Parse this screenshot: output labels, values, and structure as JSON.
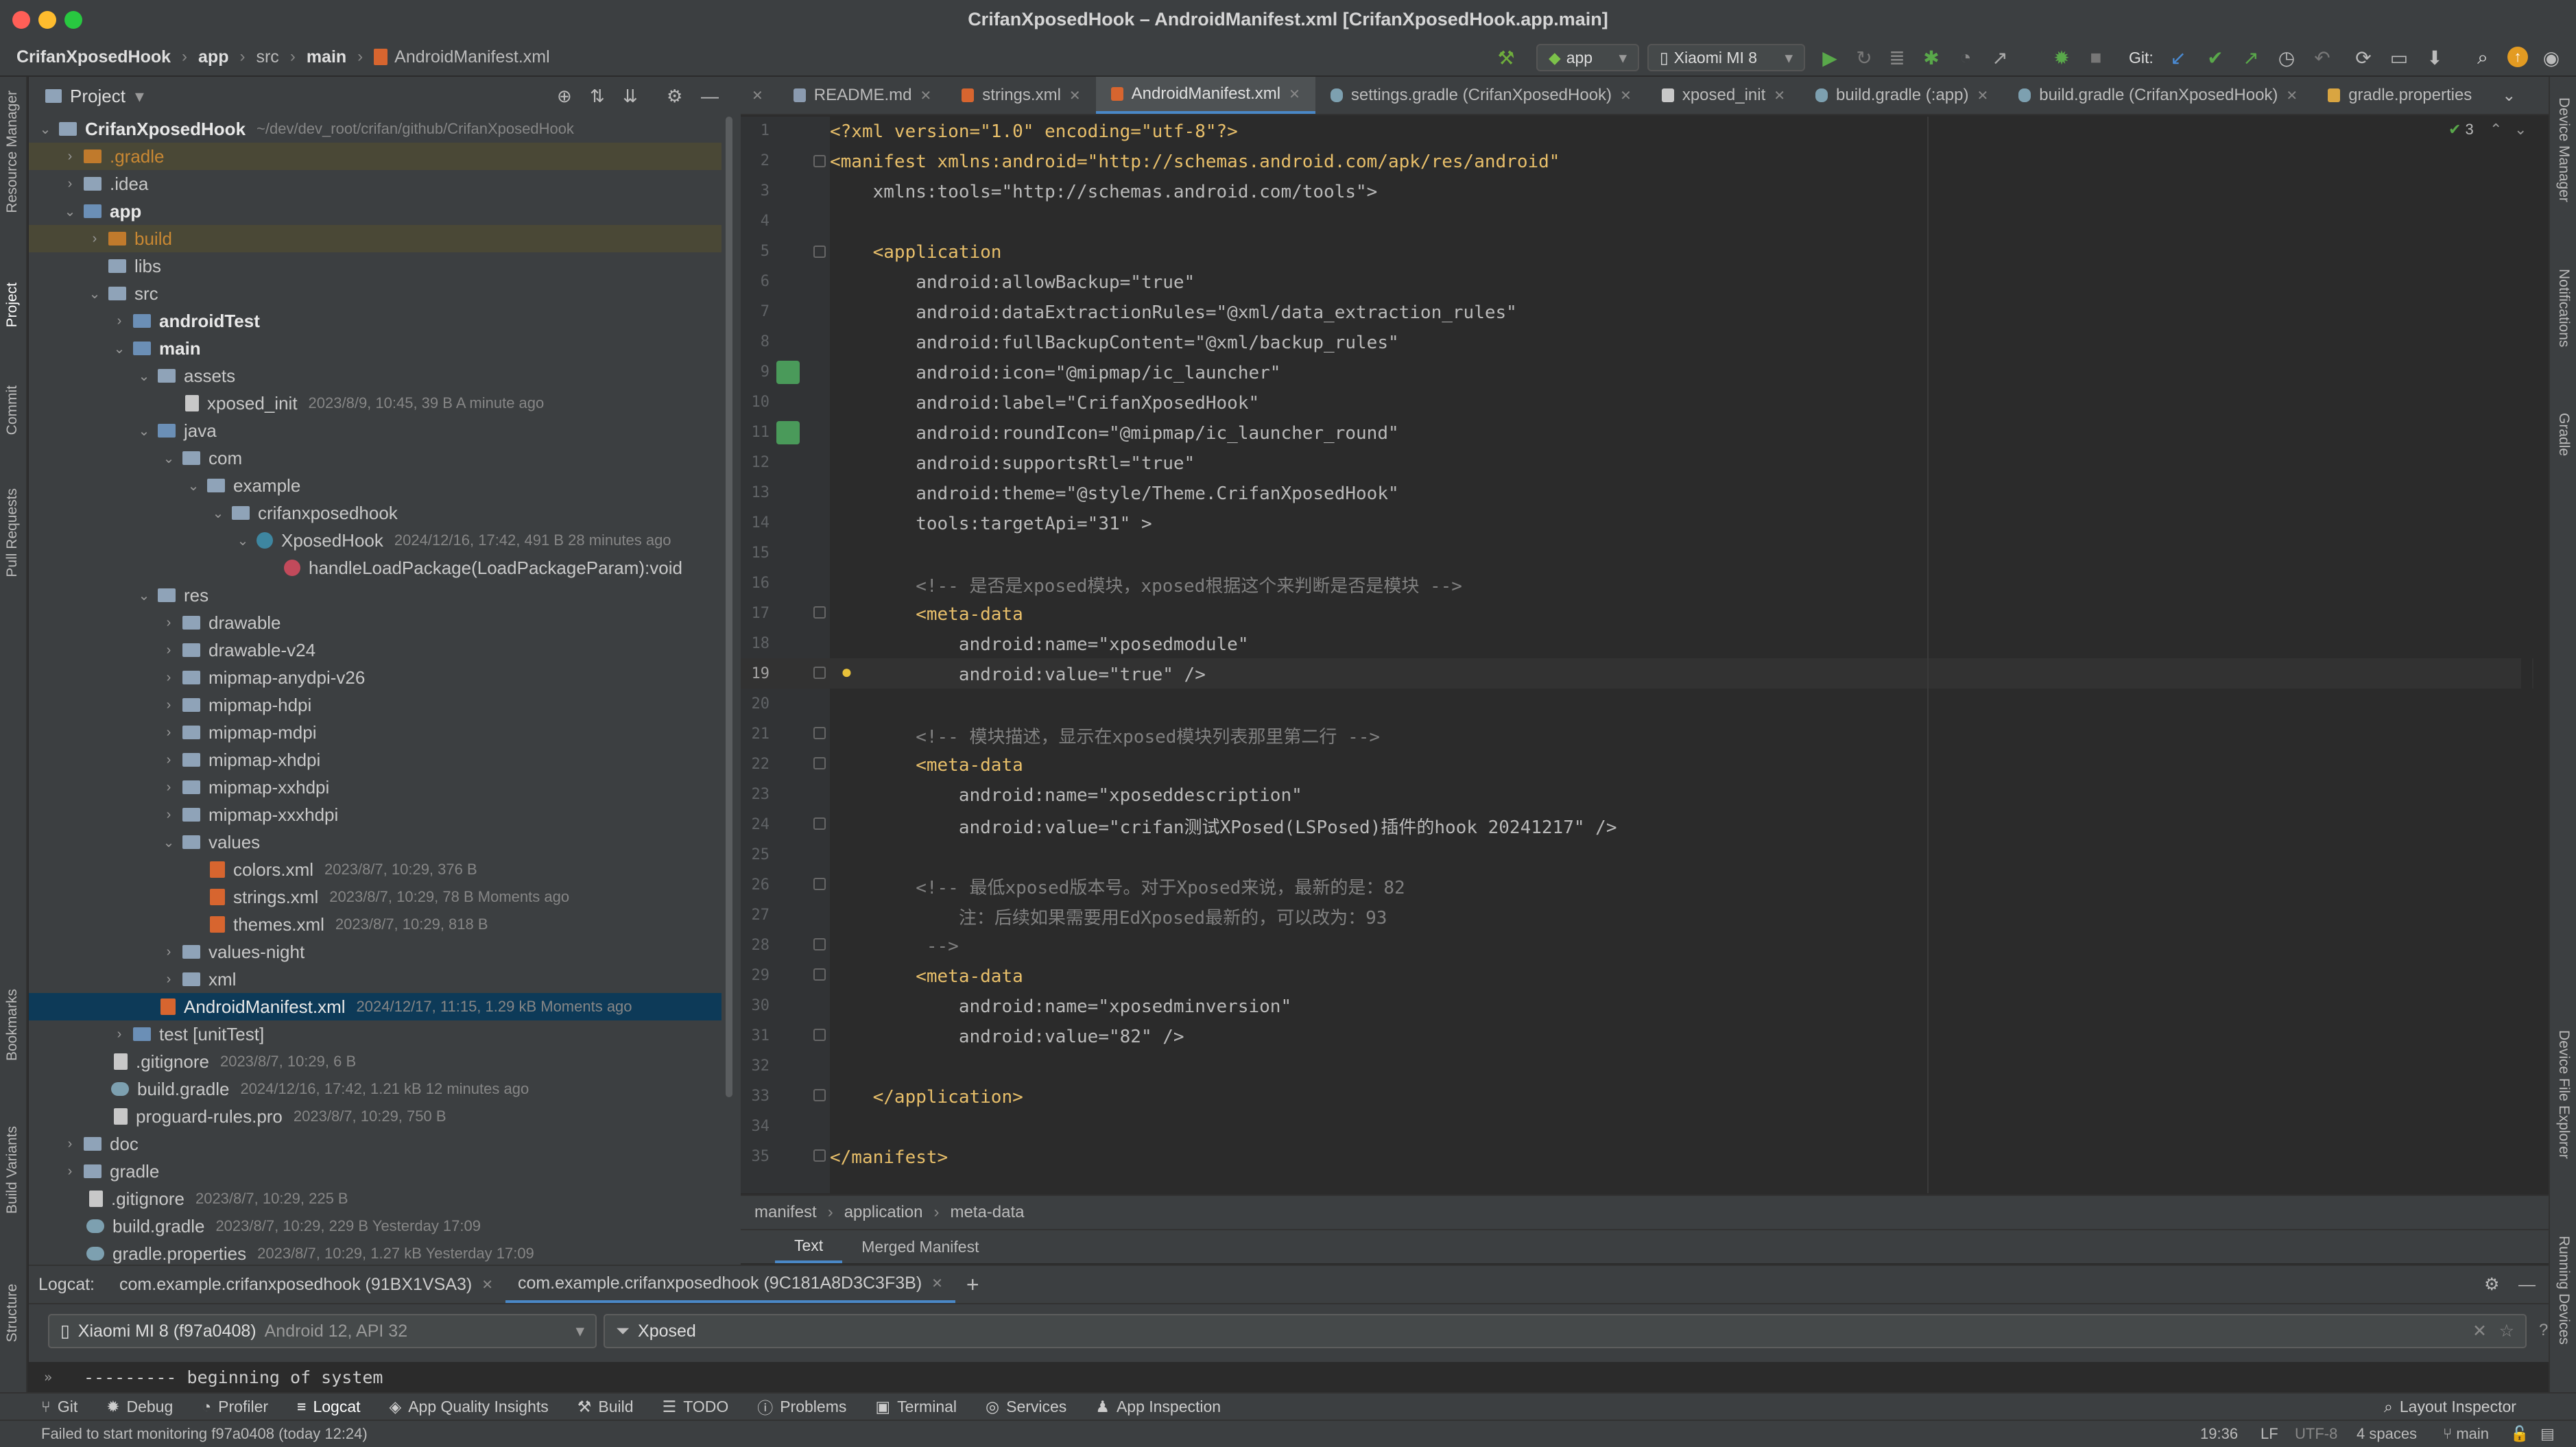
{
  "window": {
    "title": "CrifanXposedHook – AndroidManifest.xml [CrifanXposedHook.app.main]"
  },
  "navbar": {
    "crumbs": [
      "CrifanXposedHook",
      "app",
      "src",
      "main",
      "AndroidManifest.xml"
    ]
  },
  "toolbar": {
    "run_config": "app",
    "device": "Xiaomi MI 8",
    "git_label": "Git:"
  },
  "left_stripe": {
    "tabs": [
      "Resource Manager",
      "Project",
      "Commit",
      "Pull Requests",
      "Bookmarks",
      "Build Variants",
      "Structure"
    ]
  },
  "right_stripe": {
    "tabs": [
      "Device Manager",
      "Notifications",
      "Gradle",
      "Device File Explorer",
      "Running Devices"
    ]
  },
  "project": {
    "header": "Project",
    "tree": [
      {
        "name": "CrifanXposedHook",
        "meta": "~/dev/dev_root/crifan/github/CrifanXposedHook"
      },
      {
        "name": ".gradle"
      },
      {
        "name": ".idea"
      },
      {
        "name": "app"
      },
      {
        "name": "build"
      },
      {
        "name": "libs"
      },
      {
        "name": "src"
      },
      {
        "name": "androidTest"
      },
      {
        "name": "main"
      },
      {
        "name": "assets"
      },
      {
        "name": "xposed_init",
        "meta": "2023/8/9, 10:45, 39 B A minute ago"
      },
      {
        "name": "java"
      },
      {
        "name": "com"
      },
      {
        "name": "example"
      },
      {
        "name": "crifanxposedhook"
      },
      {
        "name": "XposedHook",
        "meta": "2024/12/16, 17:42, 491 B 28 minutes ago"
      },
      {
        "name": "handleLoadPackage(LoadPackageParam):void"
      },
      {
        "name": "res"
      },
      {
        "name": "drawable"
      },
      {
        "name": "drawable-v24"
      },
      {
        "name": "mipmap-anydpi-v26"
      },
      {
        "name": "mipmap-hdpi"
      },
      {
        "name": "mipmap-mdpi"
      },
      {
        "name": "mipmap-xhdpi"
      },
      {
        "name": "mipmap-xxhdpi"
      },
      {
        "name": "mipmap-xxxhdpi"
      },
      {
        "name": "values"
      },
      {
        "name": "colors.xml",
        "meta": "2023/8/7, 10:29, 376 B"
      },
      {
        "name": "strings.xml",
        "meta": "2023/8/7, 10:29, 78 B Moments ago"
      },
      {
        "name": "themes.xml",
        "meta": "2023/8/7, 10:29, 818 B"
      },
      {
        "name": "values-night"
      },
      {
        "name": "xml"
      },
      {
        "name": "AndroidManifest.xml",
        "meta": "2024/12/17, 11:15, 1.29 kB Moments ago"
      },
      {
        "name": "test [unitTest]"
      },
      {
        "name": ".gitignore",
        "meta": "2023/8/7, 10:29, 6 B"
      },
      {
        "name": "build.gradle",
        "meta": "2024/12/16, 17:42, 1.21 kB 12 minutes ago"
      },
      {
        "name": "proguard-rules.pro",
        "meta": "2023/8/7, 10:29, 750 B"
      },
      {
        "name": "doc"
      },
      {
        "name": "gradle"
      },
      {
        "name": ".gitignore",
        "meta": "2023/8/7, 10:29, 225 B"
      },
      {
        "name": "build.gradle",
        "meta": "2023/8/7, 10:29, 229 B Yesterday 17:09"
      },
      {
        "name": "gradle.properties",
        "meta": "2023/8/7, 10:29, 1.27 kB Yesterday 17:09"
      }
    ]
  },
  "editor_tabs": [
    "README.md",
    "strings.xml",
    "AndroidManifest.xml",
    "settings.gradle (CrifanXposedHook)",
    "xposed_init",
    "build.gradle (:app)",
    "build.gradle (CrifanXposedHook)",
    "gradle.properties"
  ],
  "editor": {
    "inspection_count": "3",
    "line_numbers": [
      "1",
      "2",
      "3",
      "4",
      "5",
      "6",
      "7",
      "8",
      "9",
      "10",
      "11",
      "12",
      "13",
      "14",
      "15",
      "16",
      "17",
      "18",
      "19",
      "20",
      "21",
      "22",
      "23",
      "24",
      "25",
      "26",
      "27",
      "28",
      "29",
      "30",
      "31",
      "32",
      "33",
      "34",
      "35"
    ],
    "lines": [
      "<?xml version=\"1.0\" encoding=\"utf-8\"?>",
      "<manifest xmlns:android=\"http://schemas.android.com/apk/res/android\"",
      "    xmlns:tools=\"http://schemas.android.com/tools\">",
      "",
      "    <application",
      "        android:allowBackup=\"true\"",
      "        android:dataExtractionRules=\"@xml/data_extraction_rules\"",
      "        android:fullBackupContent=\"@xml/backup_rules\"",
      "        android:icon=\"@mipmap/ic_launcher\"",
      "        android:label=\"CrifanXposedHook\"",
      "        android:roundIcon=\"@mipmap/ic_launcher_round\"",
      "        android:supportsRtl=\"true\"",
      "        android:theme=\"@style/Theme.CrifanXposedHook\"",
      "        tools:targetApi=\"31\" >",
      "",
      "        <!-- 是否是xposed模块，xposed根据这个来判断是否是模块 -->",
      "        <meta-data",
      "            android:name=\"xposedmodule\"",
      "            android:value=\"true\" />",
      "",
      "        <!-- 模块描述，显示在xposed模块列表那里第二行 -->",
      "        <meta-data",
      "            android:name=\"xposeddescription\"",
      "            android:value=\"crifan测试XPosed(LSPosed)插件的hook 20241217\" />",
      "",
      "        <!-- 最低xposed版本号。对于Xposed来说，最新的是：82",
      "            注：后续如果需要用EdXposed最新的，可以改为：93",
      "         -->",
      "        <meta-data",
      "            android:name=\"xposedminversion\"",
      "            android:value=\"82\" />",
      "",
      "    </application>",
      "",
      "</manifest>"
    ]
  },
  "breadcrumb": [
    "manifest",
    "application",
    "meta-data"
  ],
  "manifest_tabs": [
    "Text",
    "Merged Manifest"
  ],
  "logcat": {
    "label": "Logcat:",
    "tabs": [
      "com.example.crifanxposedhook (91BX1VSA3)",
      "com.example.crifanxposedhook (9C181A8D3C3F3B)"
    ],
    "device": "Xiaomi MI 8 (f97a0408)",
    "device_meta": "Android 12, API 32",
    "filter": "Xposed",
    "output": "--------- beginning of system"
  },
  "tool_windows": [
    "Git",
    "Debug",
    "Profiler",
    "Logcat",
    "App Quality Insights",
    "Build",
    "TODO",
    "Problems",
    "Terminal",
    "Services",
    "App Inspection"
  ],
  "layout_inspector": "Layout Inspector",
  "status": {
    "message": "Failed to start monitoring f97a0408 (today 12:24)",
    "position": "19:36",
    "line_sep": "LF",
    "encoding": "UTF-8",
    "indent": "4 spaces",
    "branch": "main"
  }
}
